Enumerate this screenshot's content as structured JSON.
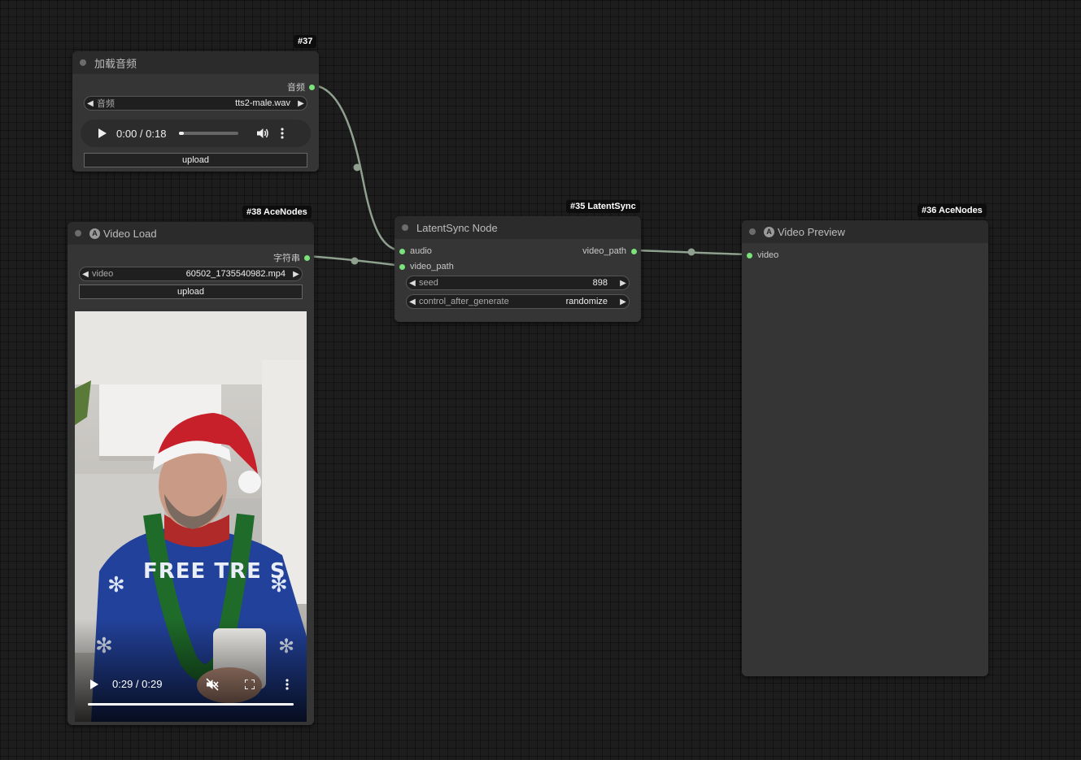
{
  "nodes": {
    "load_audio": {
      "badge": "#37",
      "title": "加载音频",
      "output_label": "音频",
      "combo": {
        "label": "音频",
        "value": "tts2-male.wav"
      },
      "player": {
        "time": "0:00 / 0:18",
        "progress": 0.08
      },
      "upload_label": "upload"
    },
    "video_load": {
      "badge": "#38 AceNodes",
      "title": "Video Load",
      "output_label": "字符串",
      "combo": {
        "label": "video",
        "value": "60502_1735540982.mp4"
      },
      "upload_label": "upload",
      "video": {
        "overlay_text": "FREE TRE S",
        "time": "0:29 / 0:29",
        "progress": 1.0
      }
    },
    "latentsync": {
      "badge": "#35 LatentSync",
      "title": "LatentSync Node",
      "inputs": [
        "audio",
        "video_path"
      ],
      "output_label": "video_path",
      "seed": {
        "label": "seed",
        "value": "898"
      },
      "control": {
        "label": "control_after_generate",
        "value": "randomize"
      }
    },
    "video_preview": {
      "badge": "#36 AceNodes",
      "title": "Video Preview",
      "input_label": "video"
    }
  },
  "icons": {
    "play": "play-icon",
    "volume": "volume-icon",
    "muted": "mute-icon",
    "more": "more-vert-icon",
    "fullscreen": "fullscreen-icon"
  },
  "colors": {
    "slot_connected": "#7be37b",
    "wire": "#8fa08f",
    "node_bg": "#353535",
    "node_title_bg": "#2b2b2b",
    "canvas_bg": "#1d1d1d"
  }
}
